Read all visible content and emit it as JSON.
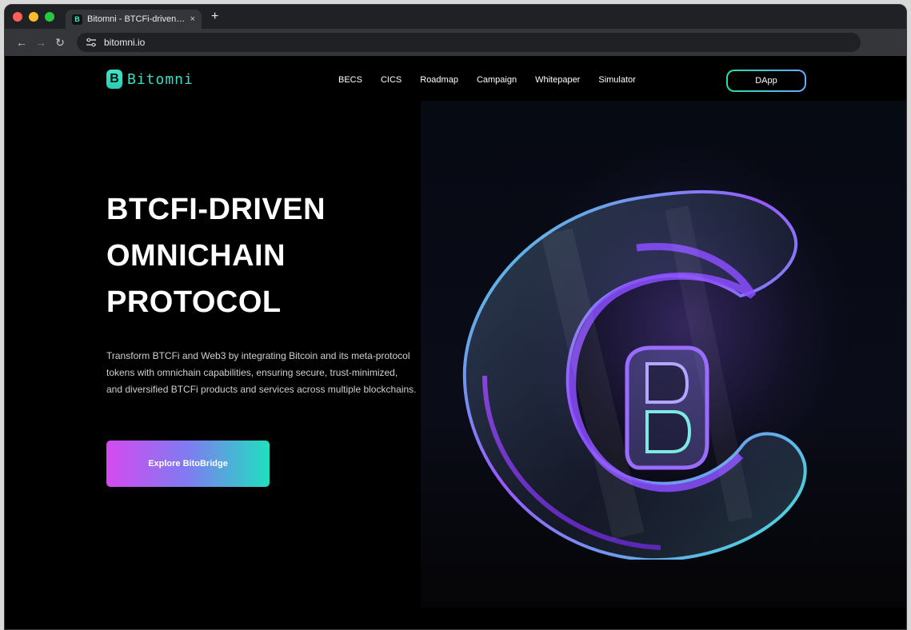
{
  "browser": {
    "tab_title": "Bitomni - BTCFi-driven Omnichain Protocol",
    "favicon_letter": "B",
    "url": "bitomni.io",
    "new_tab_symbol": "+",
    "close_symbol": "×"
  },
  "nav": {
    "logo_text": "Bitomni",
    "logo_letter": "B",
    "links": [
      "BECS",
      "CICS",
      "Roadmap",
      "Campaign",
      "Whitepaper",
      "Simulator"
    ],
    "dapp_label": "DApp"
  },
  "hero": {
    "title_lines": [
      "BTCFI-DRIVEN",
      "OMNICHAIN",
      "PROTOCOL"
    ],
    "description_lines": [
      "Transform BTCFi and Web3 by integrating Bitcoin and its meta-protocol",
      "tokens with omnichain capabilities, ensuring secure, trust-minimized,",
      "and diversified BTCFi products and services across multiple blockchains."
    ],
    "cta_label": "Explore BitoBridge",
    "art_letter": "B"
  },
  "colors": {
    "accent_teal": "#36e0c4",
    "accent_purple": "#d54af0",
    "background": "#000000"
  }
}
